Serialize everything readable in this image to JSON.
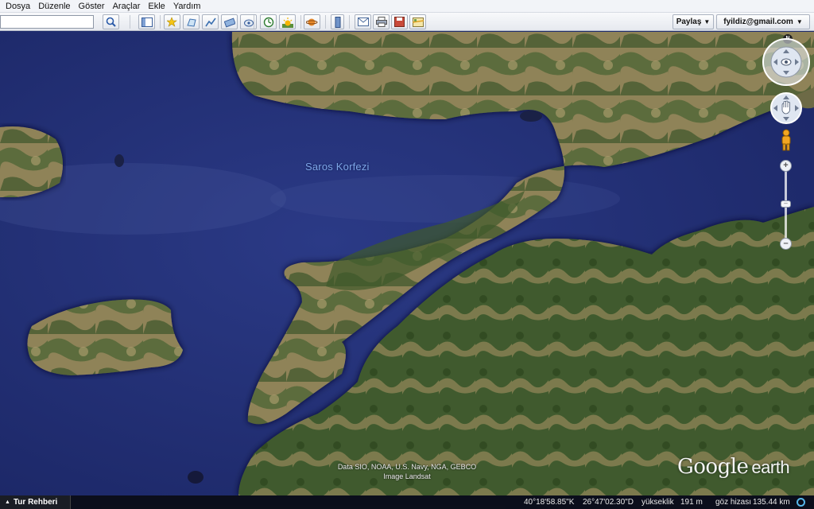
{
  "menu": [
    "Dosya",
    "Düzenle",
    "Göster",
    "Araçlar",
    "Ekle",
    "Yardım"
  ],
  "search": {
    "value": "",
    "placeholder": ""
  },
  "toolbar": {
    "icons": [
      "search-icon",
      "sidebar-toggle-icon",
      "add-placemark-icon",
      "add-polygon-icon",
      "add-path-icon",
      "add-image-overlay-icon",
      "record-tour-icon",
      "historical-imagery-icon",
      "sunlight-icon",
      "planets-icon",
      "ruler-icon",
      "email-icon",
      "print-icon",
      "save-image-icon",
      "view-in-maps-icon"
    ],
    "share_label": "Paylaş",
    "account_label": "fyildiz@gmail.com"
  },
  "map": {
    "place_label": "Saros Korfezi",
    "attribution_line1": "Data SIO, NOAA, U.S. Navy, NGA, GEBCO",
    "attribution_line2": "Image Landsat",
    "logo_google": "Google",
    "logo_earth": "earth",
    "compass_north": "N"
  },
  "statusbar": {
    "tour_label": "Tur Rehberi",
    "latitude": "40°18'58.85\"K",
    "longitude": "26°47'02.30\"D",
    "elevation_label": "yükseklik",
    "elevation_value": "191 m",
    "eye_alt_label": "göz hizası",
    "eye_alt_value": "135.44 km"
  },
  "colors": {
    "sea": "#1f2c6e",
    "land_green": "#3c5a2c",
    "land_tan": "#9a8a5c",
    "label_blue": "#7fa6e8"
  }
}
